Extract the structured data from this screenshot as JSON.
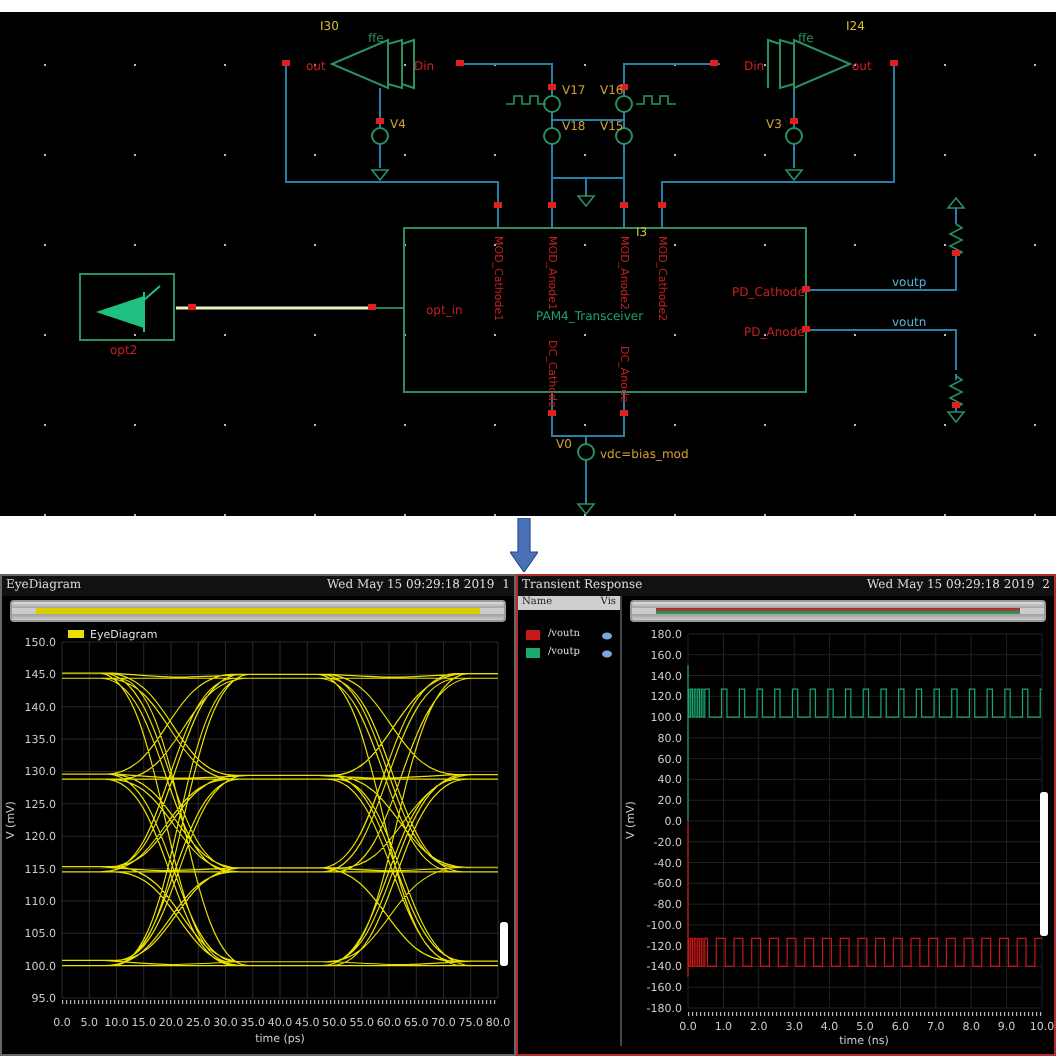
{
  "schematic": {
    "labels": [
      {
        "text": "I30"
      },
      {
        "text": "ffe"
      },
      {
        "text": "out"
      },
      {
        "text": "Din"
      },
      {
        "text": "I24"
      },
      {
        "text": "ffe"
      },
      {
        "text": "Din"
      },
      {
        "text": "out"
      },
      {
        "text": "V17"
      },
      {
        "text": "V16"
      },
      {
        "text": "V4"
      },
      {
        "text": "V18"
      },
      {
        "text": "V15"
      },
      {
        "text": "V3"
      },
      {
        "text": "I3"
      },
      {
        "text": "MOD_Cathode1"
      },
      {
        "text": "MOD_Anode1"
      },
      {
        "text": "MOD_Anode2"
      },
      {
        "text": "MOD_Cathode2"
      },
      {
        "text": "opt_in"
      },
      {
        "text": "PAM4_Transceiver"
      },
      {
        "text": "PD_Cathode"
      },
      {
        "text": "PD_Anode"
      },
      {
        "text": "DC_Cathode"
      },
      {
        "text": "DC_Anode"
      },
      {
        "text": "voutp"
      },
      {
        "text": "voutn"
      },
      {
        "text": "opt2"
      },
      {
        "text": "V0"
      },
      {
        "text": "vdc=bias_mod"
      }
    ]
  },
  "eye_window": {
    "title": "EyeDiagram",
    "timestamp": "Wed May 15 09:29:18 2019",
    "number": "1",
    "slider": {
      "level": 1
    },
    "legend": "EyeDiagram",
    "ylabel": "V (mV)",
    "xlabel": "time (ps)",
    "yticks": [
      "150.0",
      "145.0",
      "140.0",
      "135.0",
      "130.0",
      "125.0",
      "120.0",
      "115.0",
      "110.0",
      "105.0",
      "100.0",
      "95.0"
    ],
    "xticks": [
      "0.0",
      "5.0",
      "10.0",
      "15.0",
      "20.0",
      "25.0",
      "30.0",
      "35.0",
      "40.0",
      "45.0",
      "50.0",
      "55.0",
      "60.0",
      "65.0",
      "70.0",
      "75.0",
      "80.0"
    ]
  },
  "transient_window": {
    "title": "Transient Response",
    "timestamp": "Wed May 15 09:29:18 2019",
    "number": "2",
    "slider": {
      "level": 1
    },
    "columns": [
      "Name",
      "Vis"
    ],
    "signals": [
      {
        "name": "/voutn",
        "color": "#c81818"
      },
      {
        "name": "/voutp",
        "color": "#18a870"
      }
    ],
    "ylabel": "V (mV)",
    "xlabel": "time (ns)",
    "yticks": [
      "180.0",
      "160.0",
      "140.0",
      "120.0",
      "100.0",
      "80.0",
      "60.0",
      "40.0",
      "20.0",
      "0.0",
      "-20.0",
      "-40.0",
      "-60.0",
      "-80.0",
      "-100.0",
      "-120.0",
      "-140.0",
      "-160.0",
      "-180.0"
    ],
    "xticks": [
      "0.0",
      "1.0",
      "2.0",
      "3.0",
      "4.0",
      "5.0",
      "6.0",
      "7.0",
      "8.0",
      "9.0",
      "10.0"
    ]
  }
}
